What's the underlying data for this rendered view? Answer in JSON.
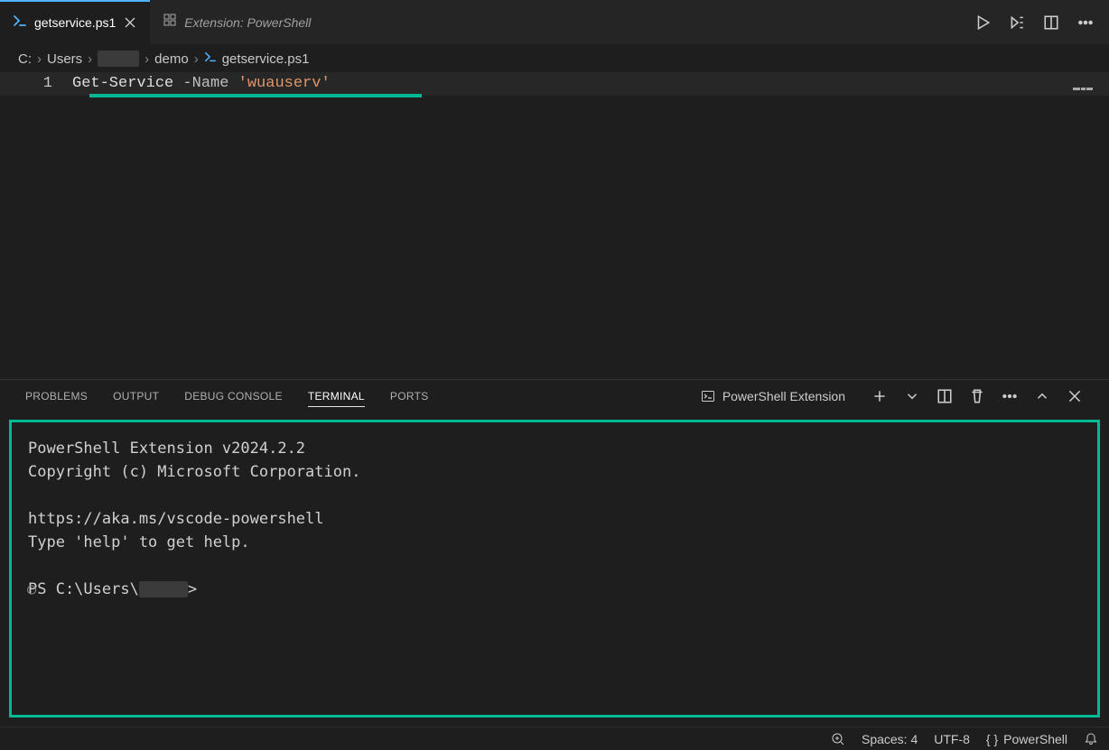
{
  "tabs": {
    "active": {
      "label": "getservice.ps1",
      "icon": "powershell-icon"
    },
    "inactive": {
      "label": "Extension: PowerShell",
      "icon": "extensions-icon"
    }
  },
  "breadcrumb": {
    "seg1": "C:",
    "seg2": "Users",
    "seg3": "demo",
    "seg4": "getservice.ps1"
  },
  "editor": {
    "line_number": "1",
    "tokens": {
      "cmd": "Get-Service",
      "param": "-Name",
      "str": "'wuauserv'"
    }
  },
  "panel_tabs": {
    "problems": "PROBLEMS",
    "output": "OUTPUT",
    "debug": "DEBUG CONSOLE",
    "terminal": "TERMINAL",
    "ports": "PORTS"
  },
  "terminal": {
    "selector": "PowerShell Extension",
    "banner1": "PowerShell Extension v2024.2.2",
    "banner2": "Copyright (c) Microsoft Corporation.",
    "link": "https://aka.ms/vscode-powershell",
    "help": "Type 'help' to get help.",
    "prompt_pre": "PS C:\\Users\\",
    "prompt_post": ">"
  },
  "status": {
    "spaces": "Spaces: 4",
    "encoding": "UTF-8",
    "language": "PowerShell"
  }
}
